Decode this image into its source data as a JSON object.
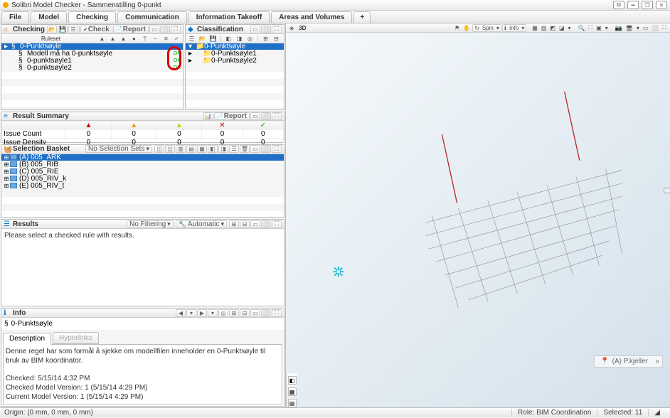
{
  "window": {
    "title": "Solibri Model Checker - Sammenstilling 0-punkt"
  },
  "tabs": {
    "items": [
      "File",
      "Model",
      "Checking",
      "Communication",
      "Information Takeoff",
      "Areas and Volumes"
    ],
    "active": 2
  },
  "checking": {
    "panel_title": "Checking",
    "check_label": "Check",
    "report_label": "Report",
    "col_ruleset": "Ruleset",
    "rows": [
      {
        "label": "0-Punktsøyle",
        "indent": 0,
        "status": ""
      },
      {
        "label": "Modell må ha 0-punktsøyle",
        "indent": 1,
        "status": "OK"
      },
      {
        "label": "0-punktsøyle1",
        "indent": 1,
        "status": "OK"
      },
      {
        "label": "0-punktsøyle2",
        "indent": 1,
        "status": "OK"
      }
    ]
  },
  "classification": {
    "panel_title": "Classification",
    "rows": [
      {
        "label": "0-Punktsøyle",
        "indent": 0
      },
      {
        "label": "0-Punktsøyle1",
        "indent": 1
      },
      {
        "label": "0-Punktsøyle2",
        "indent": 1
      }
    ]
  },
  "result_summary": {
    "panel_title": "Result Summary",
    "report_label": "Report",
    "row_labels": [
      "Issue Count",
      "Issue Density"
    ],
    "cells": [
      [
        "0",
        "0",
        "0",
        "0",
        "0"
      ],
      [
        "0",
        "0",
        "0",
        "0",
        "0"
      ]
    ]
  },
  "selection_basket": {
    "panel_title": "Selection Basket",
    "dropdown": "No Selection Sets",
    "rows": [
      "(A) 005_ARK",
      "(B) 005_RIB",
      "(C) 005_RIE",
      "(D) 005_RIV_k",
      "(E) 005_RIV_t"
    ]
  },
  "results": {
    "panel_title": "Results",
    "filter_label": "No Filtering",
    "mode_label": "Automatic",
    "message": "Please select a checked rule with results."
  },
  "info": {
    "panel_title": "Info",
    "crumb": "0-Punktsøyle",
    "tabs": {
      "description": "Description",
      "hyperlinks": "Hyperlinks"
    },
    "body_line1": "Denne regel har som formål å sjekke om modellfilen inneholder en 0-Punktsøyle til bruk av BIM koordinator.",
    "body_line2": "Checked: 5/15/14 4:32 PM",
    "body_line3": "Checked Model Version: 1 (5/15/14 4:29 PM)",
    "body_line4": "Current Model Version: 1 (5/15/14 4:29 PM)"
  },
  "viewer": {
    "panel_title": "3D",
    "spin_label": "Spin",
    "info_label": "Info",
    "badge_text": "(A) P.kjeller"
  },
  "statusbar": {
    "origin": "Origin: (0 mm, 0 mm, 0 mm)",
    "role": "Role: BIM Coordination",
    "selected": "Selected: 11"
  }
}
